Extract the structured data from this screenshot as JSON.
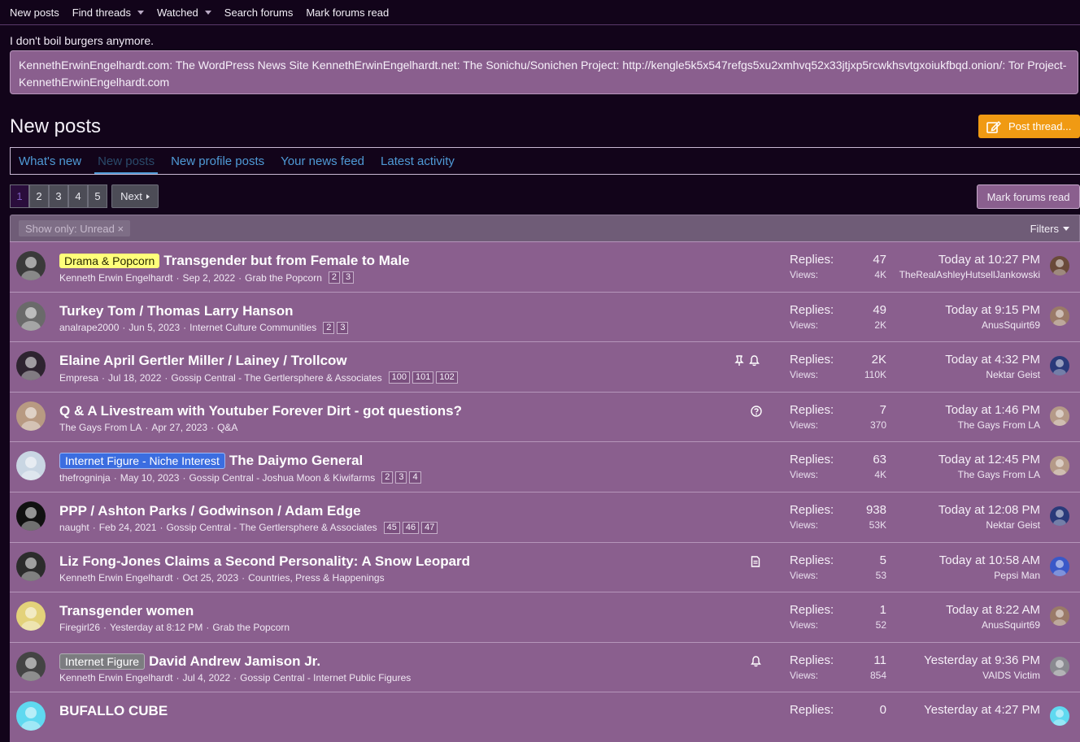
{
  "topnav": {
    "items": [
      {
        "label": "New posts"
      },
      {
        "label": "Find threads"
      },
      {
        "label": "Watched"
      },
      {
        "label": "Search forums"
      },
      {
        "label": "Mark forums read"
      }
    ]
  },
  "notice": {
    "text": "I don't boil burgers anymore.",
    "box": "KennethErwinEngelhardt.com: The WordPress News Site KennethErwinEngelhardt.net: The Sonichu/Sonichen Project: http://kengle5k5x547refgs5xu2xmhvq52x33jtjxp5rcwkhsvtgxoiukfbqd.onion/: Tor Project-KennethErwinEngelhardt.com"
  },
  "page": {
    "title": "New posts",
    "post_thread_label": "Post thread..."
  },
  "tabs": [
    {
      "label": "What's new"
    },
    {
      "label": "New posts"
    },
    {
      "label": "New profile posts"
    },
    {
      "label": "Your news feed"
    },
    {
      "label": "Latest activity"
    }
  ],
  "pagination": {
    "pages": [
      "1",
      "2",
      "3",
      "4",
      "5"
    ],
    "current": "1",
    "next_label": "Next"
  },
  "mark_read_label": "Mark forums read",
  "filter": {
    "chip": "Show only: Unread ×",
    "filters_label": "Filters"
  },
  "colors": {
    "background": "#12041a",
    "row": "#8a5f8e",
    "accent_button": "#f09a13",
    "link": "#4f9ad6"
  },
  "threads": [
    {
      "prefix": "Drama & Popcorn",
      "prefix_style": "yellow",
      "title": "Transgender but from Female to Male",
      "author": "Kenneth Erwin Engelhardt",
      "date": "Sep 2, 2022",
      "forum": "Grab the Popcorn",
      "pages": [
        "2",
        "3"
      ],
      "icons": [],
      "replies_label": "Replies:",
      "replies": "47",
      "views_label": "Views:",
      "views": "4K",
      "last_time": "Today at 10:27 PM",
      "last_user": "TheRealAshleyHutsellJankowski"
    },
    {
      "prefix": "",
      "title": "Turkey Tom / Thomas Larry Hanson",
      "author": "analrape2000",
      "date": "Jun 5, 2023",
      "forum": "Internet Culture Communities",
      "pages": [
        "2",
        "3"
      ],
      "icons": [],
      "replies_label": "Replies:",
      "replies": "49",
      "views_label": "Views:",
      "views": "2K",
      "last_time": "Today at 9:15 PM",
      "last_user": "AnusSquirt69"
    },
    {
      "prefix": "",
      "title": "Elaine April Gertler Miller / Lainey / Trollcow",
      "author": "Empresa",
      "date": "Jul 18, 2022",
      "forum": "Gossip Central - The Gertlersphere & Associates",
      "pages": [
        "100",
        "101",
        "102"
      ],
      "icons": [
        "pin-icon",
        "bell-icon"
      ],
      "replies_label": "Replies:",
      "replies": "2K",
      "views_label": "Views:",
      "views": "110K",
      "last_time": "Today at 4:32 PM",
      "last_user": "Nektar Geist"
    },
    {
      "prefix": "",
      "title": "Q & A Livestream with Youtuber Forever Dirt - got questions?",
      "author": "The Gays From LA",
      "date": "Apr 27, 2023",
      "forum": "Q&A",
      "pages": [],
      "icons": [
        "question-icon"
      ],
      "replies_label": "Replies:",
      "replies": "7",
      "views_label": "Views:",
      "views": "370",
      "last_time": "Today at 1:46 PM",
      "last_user": "The Gays From LA"
    },
    {
      "prefix": "Internet Figure - Niche Interest",
      "prefix_style": "blue",
      "title": "The Daiymo General",
      "author": "thefrogninja",
      "date": "May 10, 2023",
      "forum": "Gossip Central - Joshua Moon & Kiwifarms",
      "pages": [
        "2",
        "3",
        "4"
      ],
      "icons": [],
      "replies_label": "Replies:",
      "replies": "63",
      "views_label": "Views:",
      "views": "4K",
      "last_time": "Today at 12:45 PM",
      "last_user": "The Gays From LA"
    },
    {
      "prefix": "",
      "title": "PPP / Ashton Parks / Godwinson / Adam Edge",
      "author": "naught",
      "date": "Feb 24, 2021",
      "forum": "Gossip Central - The Gertlersphere & Associates",
      "pages": [
        "45",
        "46",
        "47"
      ],
      "icons": [],
      "replies_label": "Replies:",
      "replies": "938",
      "views_label": "Views:",
      "views": "53K",
      "last_time": "Today at 12:08 PM",
      "last_user": "Nektar Geist"
    },
    {
      "prefix": "",
      "title": "Liz Fong-Jones Claims a Second Personality: A Snow Leopard",
      "author": "Kenneth Erwin Engelhardt",
      "date": "Oct 25, 2023",
      "forum": "Countries, Press & Happenings",
      "pages": [],
      "icons": [
        "article-icon"
      ],
      "replies_label": "Replies:",
      "replies": "5",
      "views_label": "Views:",
      "views": "53",
      "last_time": "Today at 10:58 AM",
      "last_user": "Pepsi Man"
    },
    {
      "prefix": "",
      "title": "Transgender women",
      "author": "Firegirl26",
      "date": "Yesterday at 8:12 PM",
      "forum": "Grab the Popcorn",
      "pages": [],
      "icons": [],
      "replies_label": "Replies:",
      "replies": "1",
      "views_label": "Views:",
      "views": "52",
      "last_time": "Today at 8:22 AM",
      "last_user": "AnusSquirt69"
    },
    {
      "prefix": "Internet Figure",
      "prefix_style": "gray",
      "title": "David Andrew Jamison Jr.",
      "author": "Kenneth Erwin Engelhardt",
      "date": "Jul 4, 2022",
      "forum": "Gossip Central - Internet Public Figures",
      "pages": [],
      "icons": [
        "bell-icon"
      ],
      "replies_label": "Replies:",
      "replies": "11",
      "views_label": "Views:",
      "views": "854",
      "last_time": "Yesterday at 9:36 PM",
      "last_user": "VAIDS Victim"
    },
    {
      "prefix": "",
      "title": "BUFALLO CUBE",
      "author": "",
      "date": "",
      "forum": "",
      "pages": [],
      "icons": [],
      "replies_label": "Replies:",
      "replies": "0",
      "views_label": "",
      "views": "",
      "last_time": "Yesterday at 4:27 PM",
      "last_user": ""
    }
  ]
}
